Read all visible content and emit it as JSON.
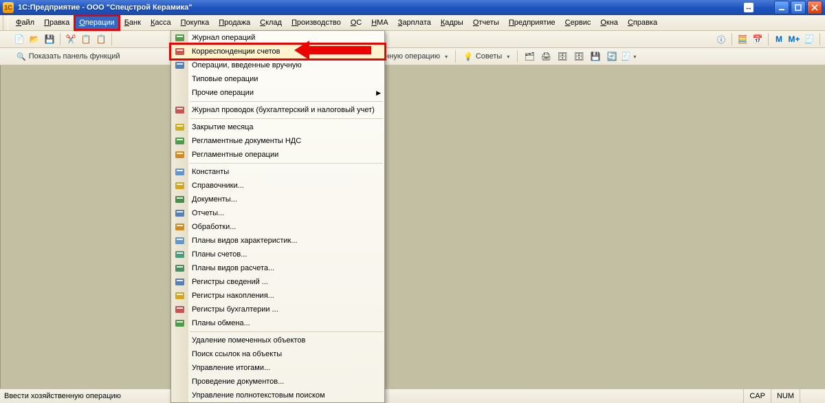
{
  "title": "1С:Предприятие - ООО \"Спецстрой Керамика\"",
  "menubar": [
    "Файл",
    "Правка",
    "Операции",
    "Банк",
    "Касса",
    "Покупка",
    "Продажа",
    "Склад",
    "Производство",
    "ОС",
    "НМА",
    "Зарплата",
    "Кадры",
    "Отчеты",
    "Предприятие",
    "Сервис",
    "Окна",
    "Справка"
  ],
  "active_menu_index": 2,
  "toolbar2": {
    "show_panel": "Показать панель функций",
    "operation_fragment": "зяйственную операцию",
    "tips": "Советы"
  },
  "dropdown": {
    "groups": [
      [
        {
          "icon": "journal",
          "label": "Журнал операций"
        },
        {
          "icon": "ak",
          "label": "Корреспонденции счетов",
          "highlight": true
        },
        {
          "icon": "manual",
          "label": "Операции, введенные вручную"
        },
        {
          "icon": "",
          "label": "Типовые операции"
        },
        {
          "icon": "",
          "label": "Прочие операции",
          "submenu": true
        }
      ],
      [
        {
          "icon": "ak",
          "label": "Журнал проводок (бухгалтерский и налоговый учет)"
        }
      ],
      [
        {
          "icon": "lock",
          "label": "Закрытие месяца"
        },
        {
          "icon": "regdoc",
          "label": "Регламентные документы НДС"
        },
        {
          "icon": "regop",
          "label": "Регламентные операции"
        }
      ],
      [
        {
          "icon": "const",
          "label": "Константы"
        },
        {
          "icon": "ref",
          "label": "Справочники..."
        },
        {
          "icon": "doc",
          "label": "Документы..."
        },
        {
          "icon": "rep",
          "label": "Отчеты..."
        },
        {
          "icon": "proc",
          "label": "Обработки..."
        },
        {
          "icon": "char",
          "label": "Планы видов характеристик..."
        },
        {
          "icon": "acc",
          "label": "Планы счетов..."
        },
        {
          "icon": "calc",
          "label": "Планы видов расчета..."
        },
        {
          "icon": "reginfo",
          "label": "Регистры сведений ..."
        },
        {
          "icon": "regacc",
          "label": "Регистры накопления..."
        },
        {
          "icon": "regbuh",
          "label": "Регистры бухгалтерии ..."
        },
        {
          "icon": "exch",
          "label": "Планы обмена..."
        }
      ],
      [
        {
          "icon": "",
          "label": "Удаление помеченных объектов"
        },
        {
          "icon": "",
          "label": "Поиск ссылок на объекты"
        },
        {
          "icon": "",
          "label": "Управление итогами..."
        },
        {
          "icon": "",
          "label": "Проведение документов..."
        },
        {
          "icon": "",
          "label": "Управление полнотекстовым поиском"
        }
      ]
    ]
  },
  "statusbar": {
    "hint": "Ввести хозяйственную операцию",
    "cap": "CAP",
    "num": "NUM"
  },
  "icon_colors": {
    "journal": "#3a8d3a",
    "ak": "#c23a3a",
    "manual": "#3a6db5",
    "lock": "#c6a800",
    "regdoc": "#2f8f2f",
    "regop": "#d07a00",
    "const": "#4a88cf",
    "ref": "#d29a00",
    "doc": "#2f7f2f",
    "rep": "#3a6db5",
    "proc": "#d07a00",
    "char": "#4a88cf",
    "acc": "#2f8f6f",
    "calc": "#2f7f4f",
    "reginfo": "#3a6db5",
    "regacc": "#d29a00",
    "regbuh": "#c23a3a",
    "exch": "#2f8f2f"
  }
}
